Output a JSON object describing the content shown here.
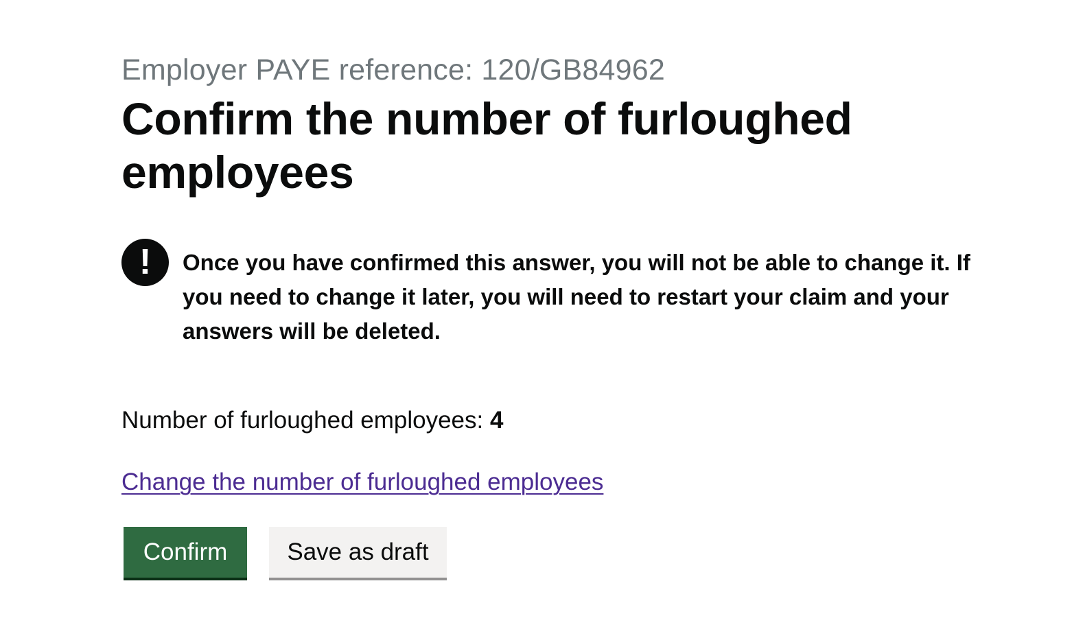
{
  "caption": "Employer PAYE reference: 120/GB84962",
  "heading": "Confirm the number of furloughed employees",
  "warning": {
    "icon": "!",
    "text": "Once you have confirmed this answer, you will not be able to change it. If you need to change it later, you will need to restart your claim and your answers will be deleted."
  },
  "summary": {
    "label": "Number of furloughed employees:",
    "value": "4"
  },
  "change_link": "Change the number of furloughed employees",
  "buttons": {
    "confirm": "Confirm",
    "save_draft": "Save as draft"
  },
  "colors": {
    "link": "#4c2c92",
    "confirm_button": "#2f6b41",
    "secondary_button": "#f3f2f1",
    "caption": "#6f777b",
    "text": "#0b0c0c"
  }
}
